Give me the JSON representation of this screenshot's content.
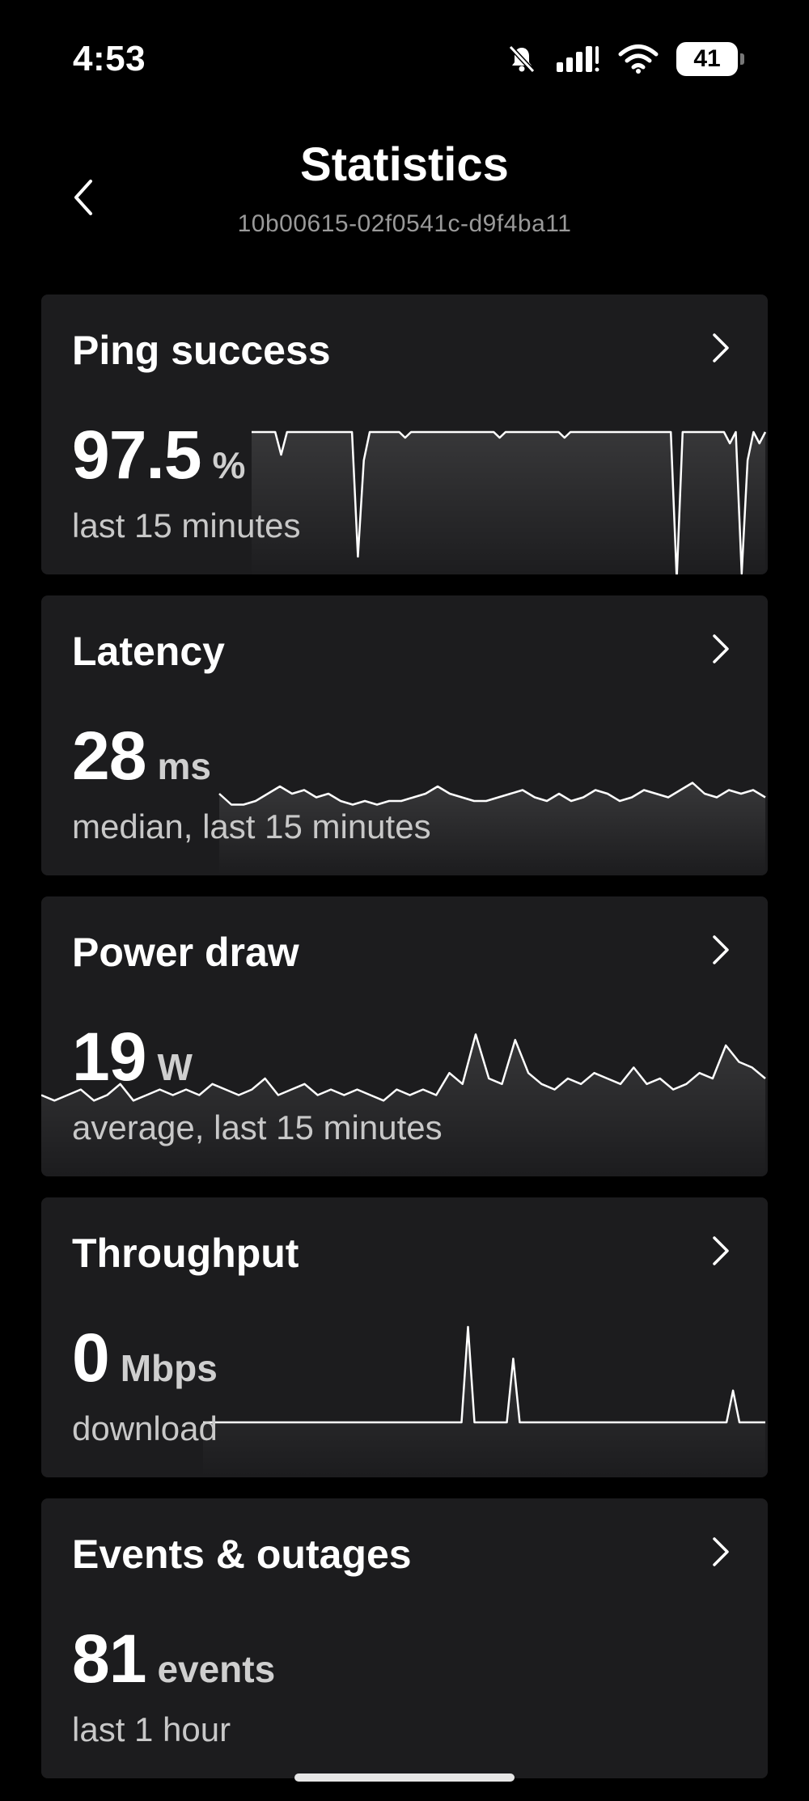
{
  "status": {
    "time": "4:53",
    "battery": "41"
  },
  "header": {
    "title": "Statistics",
    "device_id": "10b00615-02f0541c-d9f4ba11"
  },
  "cards": [
    {
      "title": "Ping success",
      "value": "97.5",
      "unit": "%",
      "subtitle": "last 15 minutes",
      "series": [
        100,
        100,
        100,
        100,
        100,
        96,
        100,
        100,
        100,
        100,
        100,
        100,
        100,
        100,
        100,
        100,
        100,
        100,
        78,
        95,
        100,
        100,
        100,
        100,
        100,
        100,
        99,
        100,
        100,
        100,
        100,
        100,
        100,
        100,
        100,
        100,
        100,
        100,
        100,
        100,
        100,
        100,
        99,
        100,
        100,
        100,
        100,
        100,
        100,
        100,
        100,
        100,
        100,
        99,
        100,
        100,
        100,
        100,
        100,
        100,
        100,
        100,
        100,
        100,
        100,
        100,
        100,
        100,
        100,
        100,
        100,
        100,
        74,
        100,
        100,
        100,
        100,
        100,
        100,
        100,
        100,
        98,
        100,
        75,
        95,
        100,
        98,
        100
      ]
    },
    {
      "title": "Latency",
      "value": "28",
      "unit": "ms",
      "subtitle": "median, last 15 minutes",
      "series": [
        30,
        27,
        27,
        28,
        30,
        32,
        30,
        31,
        29,
        30,
        28,
        27,
        28,
        27,
        28,
        28,
        29,
        30,
        32,
        30,
        29,
        28,
        28,
        29,
        30,
        31,
        29,
        28,
        30,
        28,
        29,
        31,
        30,
        28,
        29,
        31,
        30,
        29,
        31,
        33,
        30,
        29,
        31,
        30,
        31,
        29
      ]
    },
    {
      "title": "Power draw",
      "value": "19",
      "unit": "W",
      "subtitle": "average, last 15 minutes",
      "series": [
        18,
        17,
        18,
        19,
        17,
        18,
        20,
        17,
        18,
        19,
        18,
        19,
        18,
        20,
        19,
        18,
        19,
        21,
        18,
        19,
        20,
        18,
        19,
        18,
        19,
        18,
        17,
        19,
        18,
        19,
        18,
        22,
        20,
        29,
        21,
        20,
        28,
        22,
        20,
        19,
        21,
        20,
        22,
        21,
        20,
        23,
        20,
        21,
        19,
        20,
        22,
        21,
        27,
        24,
        23,
        21
      ]
    },
    {
      "title": "Throughput",
      "value": "0",
      "unit": "Mbps",
      "subtitle": "download",
      "series": [
        0,
        0,
        0,
        0,
        0,
        0,
        0,
        0,
        0,
        0,
        0,
        0,
        0,
        0,
        0,
        0,
        0,
        0,
        0,
        0,
        0,
        0,
        0,
        0,
        0,
        0,
        0,
        0,
        0,
        0,
        0,
        0,
        0,
        0,
        0,
        0,
        0,
        0,
        0,
        0,
        0,
        9,
        0,
        0,
        0,
        0,
        0,
        0,
        6,
        0,
        0,
        0,
        0,
        0,
        0,
        0,
        0,
        0,
        0,
        0,
        0,
        0,
        0,
        0,
        0,
        0,
        0,
        0,
        0,
        0,
        0,
        0,
        0,
        0,
        0,
        0,
        0,
        0,
        0,
        0,
        0,
        0,
        3,
        0,
        0,
        0,
        0,
        0
      ]
    },
    {
      "title": "Events & outages",
      "value": "81",
      "unit": "events",
      "subtitle": "last 1 hour",
      "series": []
    }
  ]
}
